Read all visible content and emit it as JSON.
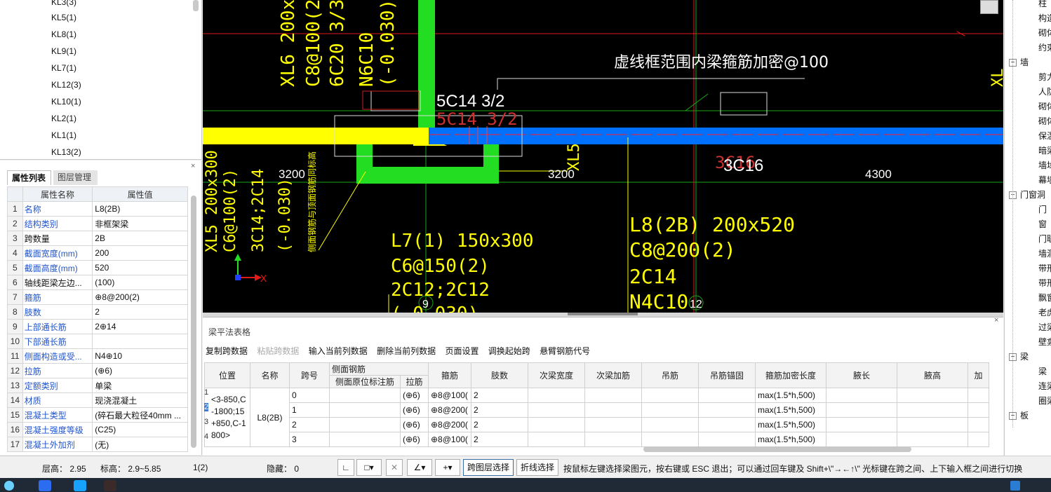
{
  "beam_list": [
    "KL3(3)",
    "KL5(1)",
    "KL8(1)",
    "KL9(1)",
    "KL7(1)",
    "KL12(3)",
    "KL10(1)",
    "KL2(1)",
    "KL1(1)",
    "KL13(2)"
  ],
  "props_panel": {
    "close": "×",
    "tabs": [
      "属性列表",
      "图层管理"
    ],
    "headers": {
      "name": "属性名称",
      "value": "属性值"
    },
    "rows": [
      {
        "n": "1",
        "name": "名称",
        "value": "L8(2B)",
        "link": true
      },
      {
        "n": "2",
        "name": "结构类别",
        "value": "非框架梁",
        "link": true
      },
      {
        "n": "3",
        "name": "跨数量",
        "value": "2B",
        "link": false
      },
      {
        "n": "4",
        "name": "截面宽度(mm)",
        "value": "200",
        "link": true
      },
      {
        "n": "5",
        "name": "截面高度(mm)",
        "value": "520",
        "link": true
      },
      {
        "n": "6",
        "name": "轴线距梁左边...",
        "value": "(100)",
        "link": false
      },
      {
        "n": "7",
        "name": "箍筋",
        "value": "⊕8@200(2)",
        "link": true
      },
      {
        "n": "8",
        "name": "肢数",
        "value": "2",
        "link": true
      },
      {
        "n": "9",
        "name": "上部通长筋",
        "value": "2⊕14",
        "link": true
      },
      {
        "n": "10",
        "name": "下部通长筋",
        "value": "",
        "link": true
      },
      {
        "n": "11",
        "name": "侧面构造或受...",
        "value": "N4⊕10",
        "link": true
      },
      {
        "n": "12",
        "name": "拉筋",
        "value": "(⊕6)",
        "link": true
      },
      {
        "n": "13",
        "name": "定额类别",
        "value": "单梁",
        "link": true
      },
      {
        "n": "14",
        "name": "材质",
        "value": "现浇混凝土",
        "link": true
      },
      {
        "n": "15",
        "name": "混凝土类型",
        "value": "(碎石最大粒径40mm ...",
        "link": true
      },
      {
        "n": "16",
        "name": "混凝土强度等级",
        "value": "(C25)",
        "link": true
      },
      {
        "n": "17",
        "name": "混凝土外加剂",
        "value": "(无)",
        "link": true
      }
    ]
  },
  "cad": {
    "texts": {
      "xl6": "XL6 200x800",
      "c8a": "C8@100(2)",
      "c6c20": "6C20 3/3;3C",
      "n6c10": "N6C10",
      "neg030a": "(-0.030)",
      "note": "虚线框范围内梁箍筋加密@100",
      "c14w": "5C14 3/2",
      "c14r": "5C14 3/2",
      "d3200a": "3200",
      "d3200b": "3200",
      "d4300": "4300",
      "c16": "3C16",
      "c16r": "3C16",
      "xl5v": "XL5",
      "xl5": "XL5 200x300",
      "c6a": "C6@100(2)",
      "c14c14": "3C14;2C14",
      "neg030b": "(-0.030)",
      "side_note": "侧面钢筋与顶面钢筋同标高",
      "l7": "L7(1) 150x300",
      "c6b": "C6@150(2)",
      "c12": "2C12;2C12",
      "neg030c": "(-0.030)",
      "l8": "L8(2B) 200x520",
      "c8b": "C8@200(2)",
      "c14b": "2C14",
      "n4c10": "N4C10",
      "axis9": "9",
      "axis12": "12",
      "x_axis": "X",
      "xl_right": "XL"
    }
  },
  "table_panel": {
    "title": "梁平法表格",
    "close": "×",
    "toolbar": {
      "copy": "复制跨数据",
      "paste": "粘贴跨数据",
      "input": "输入当前列数据",
      "delete": "删除当前列数据",
      "page": "页面设置",
      "swap": "调换起始跨",
      "cantilever": "悬臂钢筋代号"
    },
    "headers": {
      "pos": "位置",
      "name": "名称",
      "span": "跨号",
      "side_group": "侧面钢筋",
      "side_annot": "侧面原位标注筋",
      "tie": "拉筋",
      "stirrup": "箍筋",
      "legs": "肢数",
      "sec_width": "次梁宽度",
      "sec_add": "次梁加筋",
      "hanger": "吊筋",
      "hanger_anchor": "吊筋锚固",
      "dense": "箍筋加密长度",
      "haunch_len": "腋长",
      "haunch_h": "腋高",
      "more": "加"
    },
    "position": "<3-850,C-1800;15+850,C-1800>",
    "beam_name": "L8(2B)",
    "rows": [
      {
        "idx": "1",
        "span": "0",
        "tie": "(⊕6)",
        "stirrup": "⊕8@100(",
        "legs": "2",
        "dense": "max(1.5*h,500)"
      },
      {
        "idx": "2",
        "span": "1",
        "tie": "(⊕6)",
        "stirrup": "⊕8@200(",
        "legs": "2",
        "dense": "max(1.5*h,500)"
      },
      {
        "idx": "3",
        "span": "2",
        "tie": "(⊕6)",
        "stirrup": "⊕8@200(",
        "legs": "2",
        "dense": "max(1.5*h,500)"
      },
      {
        "idx": "4",
        "span": "3",
        "tie": "(⊕6)",
        "stirrup": "⊕8@100(",
        "legs": "2",
        "dense": "max(1.5*h,500)"
      }
    ]
  },
  "right_tree": {
    "items": [
      {
        "type": "item",
        "label": "柱"
      },
      {
        "type": "item",
        "label": "构造"
      },
      {
        "type": "item",
        "label": "砌体"
      },
      {
        "type": "item",
        "label": "约束"
      },
      {
        "type": "group",
        "label": "墙",
        "toggle": "−"
      },
      {
        "type": "item",
        "label": "剪力"
      },
      {
        "type": "item",
        "label": "人防"
      },
      {
        "type": "item",
        "label": "砌体"
      },
      {
        "type": "item",
        "label": "砌体"
      },
      {
        "type": "item",
        "label": "保温"
      },
      {
        "type": "item",
        "label": "暗梁"
      },
      {
        "type": "item",
        "label": "墙垛"
      },
      {
        "type": "item",
        "label": "幕墙"
      },
      {
        "type": "group",
        "label": "门窗洞",
        "toggle": "−"
      },
      {
        "type": "item",
        "label": "门"
      },
      {
        "type": "item",
        "label": "窗"
      },
      {
        "type": "item",
        "label": "门联"
      },
      {
        "type": "item",
        "label": "墙洞"
      },
      {
        "type": "item",
        "label": "带形"
      },
      {
        "type": "item",
        "label": "带形"
      },
      {
        "type": "item",
        "label": "飘窗"
      },
      {
        "type": "item",
        "label": "老虎"
      },
      {
        "type": "item",
        "label": "过梁"
      },
      {
        "type": "item",
        "label": "壁龛"
      },
      {
        "type": "group",
        "label": "梁",
        "toggle": "−"
      },
      {
        "type": "item",
        "label": "梁"
      },
      {
        "type": "item",
        "label": "连梁"
      },
      {
        "type": "item",
        "label": "圈梁"
      },
      {
        "type": "group",
        "label": "板",
        "toggle": "−"
      }
    ]
  },
  "status": {
    "floor_height": "层高：  2.95",
    "elevation": "标高：  2.9~5.85",
    "count": "1(2)",
    "hidden": "隐藏：  0",
    "cross_layer": "跨图层选择",
    "polyline": "折线选择",
    "hint": "按鼠标左键选择梁图元，按右键或 ESC 退出；可以通过回车键及 Shift+\\\"→←↑\\\" 光标键在跨之间、上下输入框之间进行切换"
  },
  "colors": {
    "yellow": "#ffff00",
    "green": "#22dd22",
    "blue": "#0070ff",
    "red": "#ff2020",
    "white": "#ffffff",
    "black": "#000000"
  }
}
